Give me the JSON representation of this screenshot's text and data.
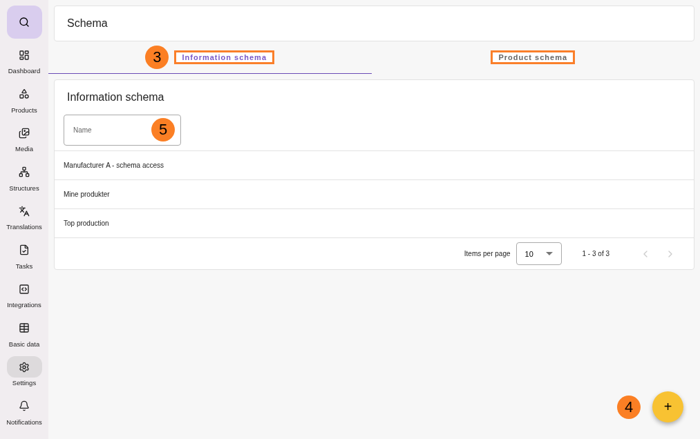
{
  "sidebar": {
    "search_selected": true,
    "items": [
      {
        "label": "Dashboard",
        "selected": false
      },
      {
        "label": "Products",
        "selected": false
      },
      {
        "label": "Media",
        "selected": false
      },
      {
        "label": "Structures",
        "selected": false
      },
      {
        "label": "Translations",
        "selected": false
      },
      {
        "label": "Tasks",
        "selected": false
      },
      {
        "label": "Integrations",
        "selected": false
      },
      {
        "label": "Basic data",
        "selected": false
      },
      {
        "label": "Settings",
        "selected": true
      },
      {
        "label": "Notifications",
        "selected": false
      }
    ]
  },
  "header": {
    "title": "Schema"
  },
  "tabs": [
    {
      "label": "Information schema",
      "selected": true,
      "callout": "3"
    },
    {
      "label": "Product schema",
      "selected": false
    }
  ],
  "panel": {
    "title": "Information schema",
    "filter": {
      "placeholder": "Name",
      "callout": "5"
    },
    "rows": [
      "Manufacturer A - schema access",
      "Mine produkter",
      "Top production"
    ],
    "paginator": {
      "label": "Items per page",
      "page_size": "10",
      "range": "1 - 3 of 3"
    }
  },
  "fab": {
    "label": "+",
    "callout": "4"
  }
}
